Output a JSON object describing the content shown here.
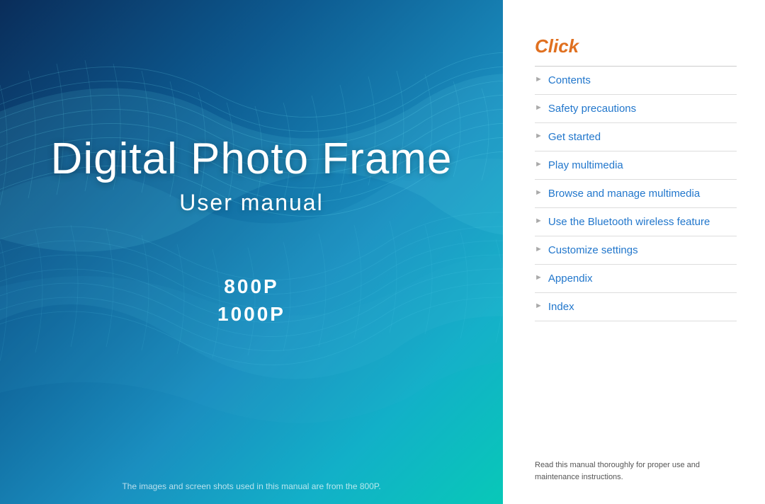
{
  "left": {
    "title": "Digital Photo Frame",
    "subtitle": "User manual",
    "model1": "800P",
    "model2": "1000P",
    "caption": "The images and screen shots used in this manual are from the 800P."
  },
  "right": {
    "click_label": "Click",
    "nav_items": [
      {
        "id": "contents",
        "label": "Contents"
      },
      {
        "id": "safety-precautions",
        "label": "Safety precautions"
      },
      {
        "id": "get-started",
        "label": "Get started"
      },
      {
        "id": "play-multimedia",
        "label": "Play multimedia"
      },
      {
        "id": "browse-manage",
        "label": "Browse and manage multimedia"
      },
      {
        "id": "bluetooth",
        "label": "Use the Bluetooth wireless feature"
      },
      {
        "id": "customize-settings",
        "label": "Customize settings"
      },
      {
        "id": "appendix",
        "label": "Appendix"
      },
      {
        "id": "index",
        "label": "Index"
      }
    ],
    "manual_note": "Read this manual thoroughly for proper use and maintenance instructions."
  }
}
